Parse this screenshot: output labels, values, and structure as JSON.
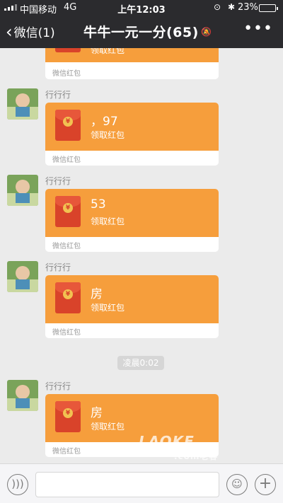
{
  "status": {
    "carrier": "中国移动",
    "network": "4G",
    "time": "上午12:03",
    "battery": "23%",
    "battery_level": 0.23
  },
  "nav": {
    "back_label": "微信(1)",
    "title": "牛牛一元一分(65)"
  },
  "top_partial": {
    "sub": "领取红包",
    "footer": "微信红包"
  },
  "messages": [
    {
      "sender": "行行行",
      "text": "，97",
      "sub": "领取红包",
      "footer": "微信红包"
    },
    {
      "sender": "行行行",
      "text": "53",
      "sub": "领取红包",
      "footer": "微信红包"
    },
    {
      "sender": "行行行",
      "text": "房",
      "sub": "领取红包",
      "footer": "微信红包"
    },
    {
      "sender": "行行行",
      "text": "房",
      "sub": "领取红包",
      "footer": "微信红包"
    }
  ],
  "time_divider": "凌晨0:02",
  "watermark": {
    "main": "LAOKE",
    "sub": ".com老客"
  },
  "icons": {
    "back": "chevron-left-icon",
    "mute": "mute-icon",
    "more": "more-icon",
    "voice": "voice-icon",
    "emoji": "emoji-icon",
    "plus": "plus-icon"
  },
  "colors": {
    "header": "#2b2b2e",
    "redpacket": "#f69e3c",
    "envelope": "#d9432a"
  }
}
